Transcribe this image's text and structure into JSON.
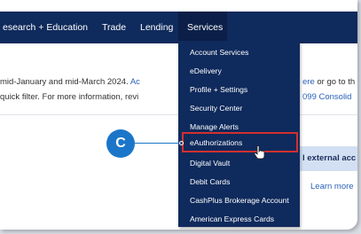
{
  "nav": {
    "items": [
      "esearch + Education",
      "Trade",
      "Lending",
      "Services"
    ]
  },
  "banner": {
    "line1_prefix": "mid-January and mid-March 2024.",
    "line1_link": "Ac",
    "line1_link2": "ere",
    "line1_suffix": "or go to th",
    "line2_prefix": "quick filter. For more information, revi",
    "line2_link": "099 Consolid"
  },
  "promo": {
    "heading": "l external acc",
    "link": "Learn more"
  },
  "menu": {
    "items": [
      "Account Services",
      "eDelivery",
      "Profile + Settings",
      "Security Center",
      "Manage Alerts",
      "eAuthorizations",
      "Digital Vault",
      "Debit Cards",
      "CashPlus Brokerage Account",
      "American Express Cards"
    ],
    "highlighted": "eAuthorizations"
  },
  "callout": {
    "label": "C"
  },
  "colors": {
    "nav_bg": "#0f2a5c",
    "highlight_border": "#d2302f",
    "callout_bg": "#1b76c9",
    "link": "#2a62b8"
  }
}
